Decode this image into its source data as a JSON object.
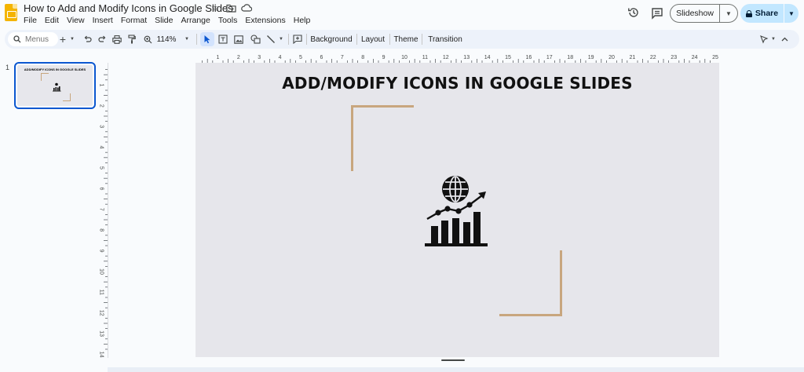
{
  "app": {
    "doc_title": "How to Add and Modify Icons in Google Slides",
    "menu": [
      "File",
      "Edit",
      "View",
      "Insert",
      "Format",
      "Slide",
      "Arrange",
      "Tools",
      "Extensions",
      "Help"
    ],
    "slideshow_label": "Slideshow",
    "share_label": "Share"
  },
  "toolbar": {
    "search_placeholder": "Menus",
    "zoom": "114%",
    "background_label": "Background",
    "layout_label": "Layout",
    "theme_label": "Theme",
    "transition_label": "Transition"
  },
  "filmstrip": {
    "slide_number": "1",
    "thumb_title": "ADD/MODIFY ICONS IN GOOGLE SLIDES"
  },
  "rulers": {
    "horizontal": [
      "1",
      "2",
      "3",
      "4",
      "5",
      "6",
      "7",
      "8",
      "9",
      "10",
      "11",
      "12",
      "13",
      "14",
      "15",
      "16",
      "17",
      "18",
      "19",
      "20",
      "21",
      "22",
      "23",
      "24",
      "25"
    ],
    "vertical": [
      "1",
      "2",
      "3",
      "4",
      "5",
      "6",
      "7",
      "8",
      "9",
      "10",
      "11",
      "12",
      "13",
      "14"
    ]
  },
  "slide": {
    "title": "ADD/MODIFY ICONS IN GOOGLE SLIDES",
    "accent_color": "#c8a67e",
    "background_color": "#e6e6eb",
    "icon": "global-growth-chart-icon"
  },
  "colors": {
    "selection": "#0b57d0",
    "share_bg": "#c2e7ff",
    "toolbar_bg": "#edf2fa"
  }
}
